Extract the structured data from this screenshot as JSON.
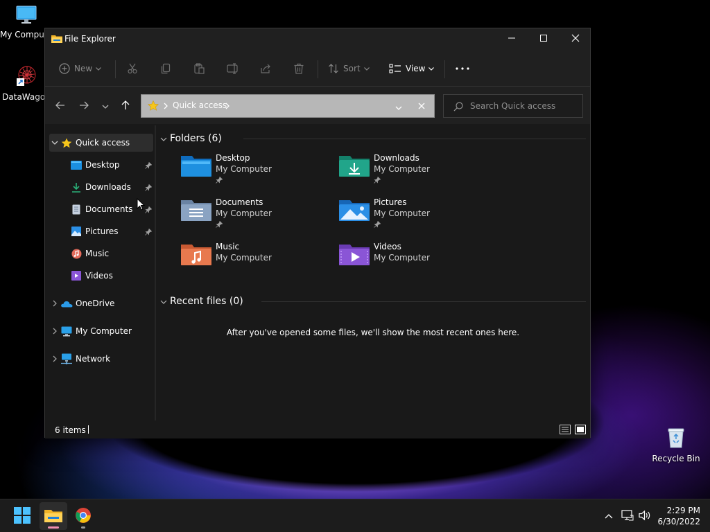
{
  "desktop": {
    "icons": [
      {
        "label": "My Computer",
        "icon": "monitor-icon"
      },
      {
        "label": "DataWagon",
        "icon": "datawagon-shortcut-icon"
      },
      {
        "label": "Recycle Bin",
        "icon": "recycle-bin-icon"
      }
    ]
  },
  "window": {
    "title": "File Explorer",
    "controls": {
      "minimize": "minimize-icon",
      "maximize": "maximize-icon",
      "close": "close-icon"
    }
  },
  "commandbar": {
    "new_label": "New",
    "sort_label": "Sort",
    "view_label": "View",
    "icons": [
      "plus-circle-icon",
      "cut-icon",
      "copy-icon",
      "paste-icon",
      "rename-icon",
      "share-icon",
      "delete-icon",
      "sort-icon",
      "view-icon",
      "more-icon"
    ]
  },
  "address": {
    "location": "Quick access",
    "search_placeholder": "Search Quick access"
  },
  "sidebar": {
    "quick_access": "Quick access",
    "pinned": [
      {
        "label": "Desktop",
        "icon": "desktop-folder-icon",
        "pinned": true
      },
      {
        "label": "Downloads",
        "icon": "download-arrow-icon",
        "pinned": true
      },
      {
        "label": "Documents",
        "icon": "document-icon",
        "pinned": true
      },
      {
        "label": "Pictures",
        "icon": "pictures-icon",
        "pinned": true
      },
      {
        "label": "Music",
        "icon": "music-icon",
        "pinned": false
      },
      {
        "label": "Videos",
        "icon": "videos-icon",
        "pinned": false
      }
    ],
    "roots": [
      {
        "label": "OneDrive",
        "icon": "cloud-icon"
      },
      {
        "label": "My Computer",
        "icon": "monitor-icon"
      },
      {
        "label": "Network",
        "icon": "network-icon"
      }
    ]
  },
  "content": {
    "folders_header": "Folders (6)",
    "folders": [
      {
        "name": "Desktop",
        "location": "My Computer",
        "pinned": true,
        "color": "#1e90e0"
      },
      {
        "name": "Downloads",
        "location": "My Computer",
        "pinned": true,
        "color": "#21a58a"
      },
      {
        "name": "Documents",
        "location": "My Computer",
        "pinned": true,
        "color": "#8aa3c2"
      },
      {
        "name": "Pictures",
        "location": "My Computer",
        "pinned": true,
        "color": "#2b8fe6"
      },
      {
        "name": "Music",
        "location": "My Computer",
        "pinned": false,
        "color": "#e8794e"
      },
      {
        "name": "Videos",
        "location": "My Computer",
        "pinned": false,
        "color": "#8a55d6"
      }
    ],
    "recent_header": "Recent files (0)",
    "recent_empty": "After you've opened some files, we'll show the most recent ones here."
  },
  "statusbar": {
    "items": "6 items"
  },
  "taskbar": {
    "apps": [
      "windows-start-icon",
      "file-explorer-icon",
      "chrome-icon"
    ],
    "tray": [
      "chevron-up-icon",
      "network-icon",
      "volume-icon"
    ],
    "time": "2:29 PM",
    "date": "6/30/2022"
  },
  "colors": {
    "accent_star": "#f5c51b",
    "window_bg": "#191919",
    "address_bg": "#b7b7b7"
  }
}
